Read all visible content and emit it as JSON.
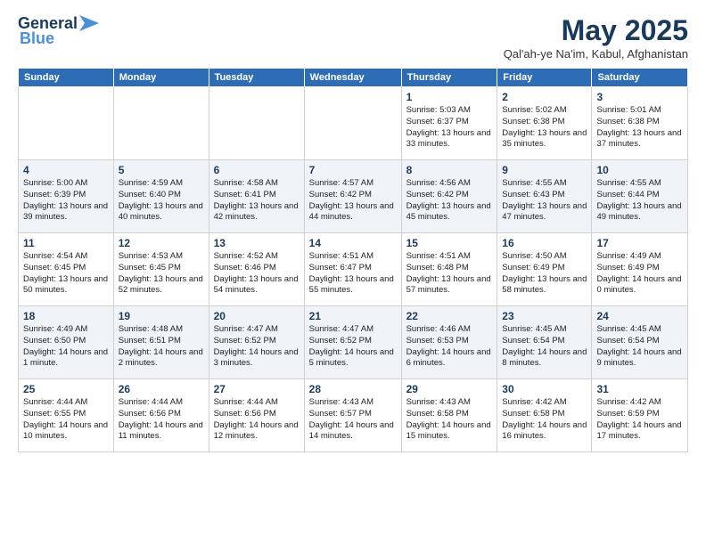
{
  "logo": {
    "line1": "General",
    "line2": "Blue"
  },
  "header": {
    "month": "May 2025",
    "location": "Qal'ah-ye Na'im, Kabul, Afghanistan"
  },
  "weekdays": [
    "Sunday",
    "Monday",
    "Tuesday",
    "Wednesday",
    "Thursday",
    "Friday",
    "Saturday"
  ],
  "weeks": [
    [
      {
        "day": "",
        "info": ""
      },
      {
        "day": "",
        "info": ""
      },
      {
        "day": "",
        "info": ""
      },
      {
        "day": "",
        "info": ""
      },
      {
        "day": "1",
        "info": "Sunrise: 5:03 AM\nSunset: 6:37 PM\nDaylight: 13 hours\nand 33 minutes."
      },
      {
        "day": "2",
        "info": "Sunrise: 5:02 AM\nSunset: 6:38 PM\nDaylight: 13 hours\nand 35 minutes."
      },
      {
        "day": "3",
        "info": "Sunrise: 5:01 AM\nSunset: 6:38 PM\nDaylight: 13 hours\nand 37 minutes."
      }
    ],
    [
      {
        "day": "4",
        "info": "Sunrise: 5:00 AM\nSunset: 6:39 PM\nDaylight: 13 hours\nand 39 minutes."
      },
      {
        "day": "5",
        "info": "Sunrise: 4:59 AM\nSunset: 6:40 PM\nDaylight: 13 hours\nand 40 minutes."
      },
      {
        "day": "6",
        "info": "Sunrise: 4:58 AM\nSunset: 6:41 PM\nDaylight: 13 hours\nand 42 minutes."
      },
      {
        "day": "7",
        "info": "Sunrise: 4:57 AM\nSunset: 6:42 PM\nDaylight: 13 hours\nand 44 minutes."
      },
      {
        "day": "8",
        "info": "Sunrise: 4:56 AM\nSunset: 6:42 PM\nDaylight: 13 hours\nand 45 minutes."
      },
      {
        "day": "9",
        "info": "Sunrise: 4:55 AM\nSunset: 6:43 PM\nDaylight: 13 hours\nand 47 minutes."
      },
      {
        "day": "10",
        "info": "Sunrise: 4:55 AM\nSunset: 6:44 PM\nDaylight: 13 hours\nand 49 minutes."
      }
    ],
    [
      {
        "day": "11",
        "info": "Sunrise: 4:54 AM\nSunset: 6:45 PM\nDaylight: 13 hours\nand 50 minutes."
      },
      {
        "day": "12",
        "info": "Sunrise: 4:53 AM\nSunset: 6:45 PM\nDaylight: 13 hours\nand 52 minutes."
      },
      {
        "day": "13",
        "info": "Sunrise: 4:52 AM\nSunset: 6:46 PM\nDaylight: 13 hours\nand 54 minutes."
      },
      {
        "day": "14",
        "info": "Sunrise: 4:51 AM\nSunset: 6:47 PM\nDaylight: 13 hours\nand 55 minutes."
      },
      {
        "day": "15",
        "info": "Sunrise: 4:51 AM\nSunset: 6:48 PM\nDaylight: 13 hours\nand 57 minutes."
      },
      {
        "day": "16",
        "info": "Sunrise: 4:50 AM\nSunset: 6:49 PM\nDaylight: 13 hours\nand 58 minutes."
      },
      {
        "day": "17",
        "info": "Sunrise: 4:49 AM\nSunset: 6:49 PM\nDaylight: 14 hours\nand 0 minutes."
      }
    ],
    [
      {
        "day": "18",
        "info": "Sunrise: 4:49 AM\nSunset: 6:50 PM\nDaylight: 14 hours\nand 1 minute."
      },
      {
        "day": "19",
        "info": "Sunrise: 4:48 AM\nSunset: 6:51 PM\nDaylight: 14 hours\nand 2 minutes."
      },
      {
        "day": "20",
        "info": "Sunrise: 4:47 AM\nSunset: 6:52 PM\nDaylight: 14 hours\nand 3 minutes."
      },
      {
        "day": "21",
        "info": "Sunrise: 4:47 AM\nSunset: 6:52 PM\nDaylight: 14 hours\nand 5 minutes."
      },
      {
        "day": "22",
        "info": "Sunrise: 4:46 AM\nSunset: 6:53 PM\nDaylight: 14 hours\nand 6 minutes."
      },
      {
        "day": "23",
        "info": "Sunrise: 4:45 AM\nSunset: 6:54 PM\nDaylight: 14 hours\nand 8 minutes."
      },
      {
        "day": "24",
        "info": "Sunrise: 4:45 AM\nSunset: 6:54 PM\nDaylight: 14 hours\nand 9 minutes."
      }
    ],
    [
      {
        "day": "25",
        "info": "Sunrise: 4:44 AM\nSunset: 6:55 PM\nDaylight: 14 hours\nand 10 minutes."
      },
      {
        "day": "26",
        "info": "Sunrise: 4:44 AM\nSunset: 6:56 PM\nDaylight: 14 hours\nand 11 minutes."
      },
      {
        "day": "27",
        "info": "Sunrise: 4:44 AM\nSunset: 6:56 PM\nDaylight: 14 hours\nand 12 minutes."
      },
      {
        "day": "28",
        "info": "Sunrise: 4:43 AM\nSunset: 6:57 PM\nDaylight: 14 hours\nand 14 minutes."
      },
      {
        "day": "29",
        "info": "Sunrise: 4:43 AM\nSunset: 6:58 PM\nDaylight: 14 hours\nand 15 minutes."
      },
      {
        "day": "30",
        "info": "Sunrise: 4:42 AM\nSunset: 6:58 PM\nDaylight: 14 hours\nand 16 minutes."
      },
      {
        "day": "31",
        "info": "Sunrise: 4:42 AM\nSunset: 6:59 PM\nDaylight: 14 hours\nand 17 minutes."
      }
    ]
  ]
}
